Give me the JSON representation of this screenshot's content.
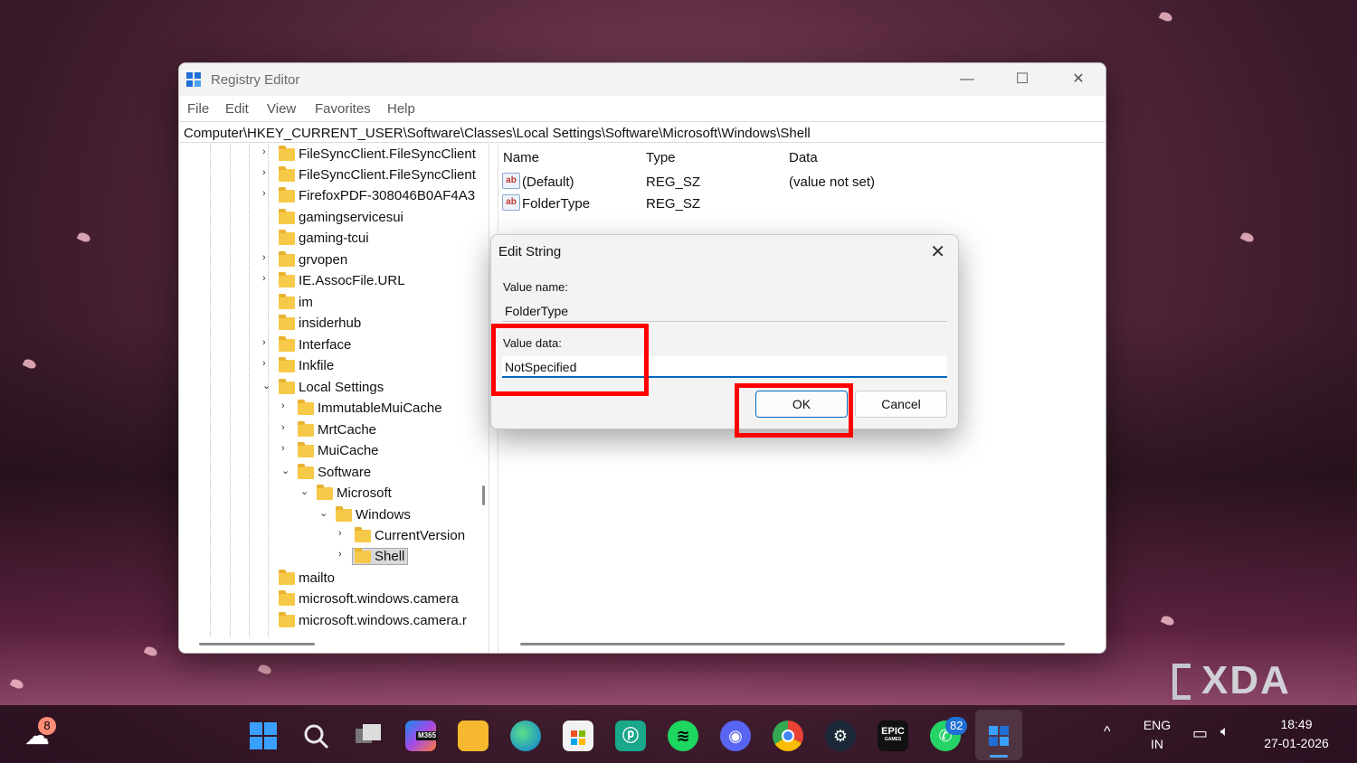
{
  "window": {
    "title": "Registry Editor",
    "controls": {
      "minimize": "—",
      "maximize": "☐",
      "close": "✕"
    },
    "menu": [
      "File",
      "Edit",
      "View",
      "Favorites",
      "Help"
    ],
    "address": "Computer\\HKEY_CURRENT_USER\\Software\\Classes\\Local Settings\\Software\\Microsoft\\Windows\\Shell"
  },
  "tree": [
    {
      "label": "FileSyncClient.FileSyncClient",
      "chevron": "›"
    },
    {
      "label": "FileSyncClient.FileSyncClient",
      "chevron": "›"
    },
    {
      "label": "FirefoxPDF-308046B0AF4A3",
      "chevron": "›"
    },
    {
      "label": "gamingservicesui",
      "chevron": ""
    },
    {
      "label": "gaming-tcui",
      "chevron": ""
    },
    {
      "label": "grvopen",
      "chevron": "›"
    },
    {
      "label": "IE.AssocFile.URL",
      "chevron": "›"
    },
    {
      "label": "im",
      "chevron": ""
    },
    {
      "label": "insiderhub",
      "chevron": ""
    },
    {
      "label": "Interface",
      "chevron": "›"
    },
    {
      "label": "Inkfile",
      "chevron": "›"
    },
    {
      "label": "Local Settings",
      "chevron": "⌄"
    },
    {
      "label": "ImmutableMuiCache",
      "chevron": "›"
    },
    {
      "label": "MrtCache",
      "chevron": "›"
    },
    {
      "label": "MuiCache",
      "chevron": "›"
    },
    {
      "label": "Software",
      "chevron": "⌄"
    },
    {
      "label": "Microsoft",
      "chevron": "⌄"
    },
    {
      "label": "Windows",
      "chevron": "⌄"
    },
    {
      "label": "CurrentVersion",
      "chevron": "›"
    },
    {
      "label": "Shell",
      "chevron": "›",
      "selected": true
    },
    {
      "label": "mailto",
      "chevron": ""
    },
    {
      "label": "microsoft.windows.camera",
      "chevron": ""
    },
    {
      "label": "microsoft.windows.camera.r",
      "chevron": ""
    }
  ],
  "values": {
    "columns": {
      "name": "Name",
      "type": "Type",
      "data": "Data"
    },
    "rows": [
      {
        "name": "(Default)",
        "type": "REG_SZ",
        "data": "(value not set)",
        "icon": "ab"
      },
      {
        "name": "FolderType",
        "type": "REG_SZ",
        "data": "",
        "icon": "ab"
      }
    ]
  },
  "dialog": {
    "title": "Edit String",
    "close": "✕",
    "value_name_label": "Value name:",
    "value_name": "FolderType",
    "value_data_label": "Value data:",
    "value_data": "NotSpecified",
    "ok": "OK",
    "cancel": "Cancel",
    "highlight_color": "#ff0000"
  },
  "watermark": {
    "text": "XDA"
  },
  "taskbar": {
    "weather_badge": "8",
    "whatsapp_badge": "82",
    "microsoft365_label": "M365",
    "epic_label": "EPIC",
    "epic_sub": "GAMES",
    "language_primary": "ENG",
    "language_secondary": "IN",
    "time": "18:49",
    "date": "27-01-2026",
    "tray_chevron": "^"
  },
  "colors": {
    "accent": "#0067c0",
    "folder": "#f7c948",
    "highlight": "#ff0000"
  }
}
